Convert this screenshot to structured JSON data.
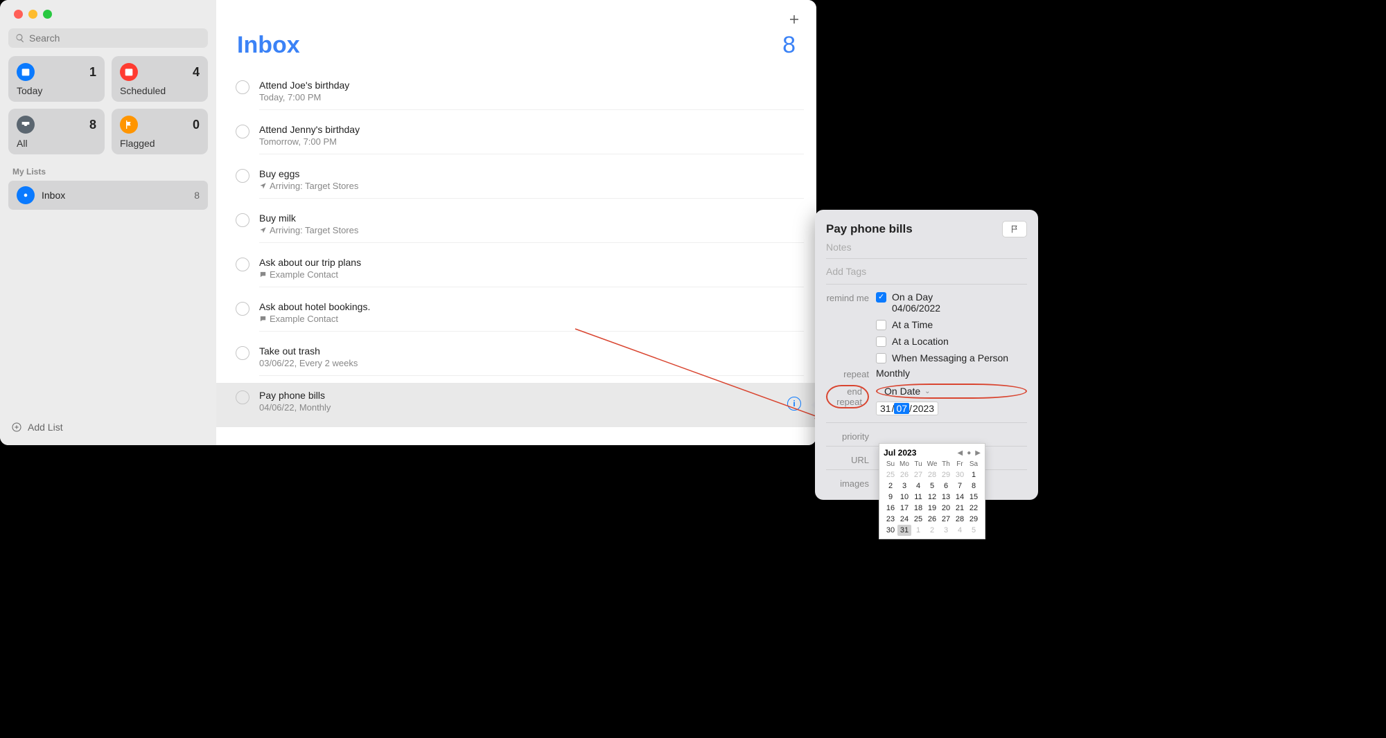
{
  "window": {
    "search_placeholder": "Search",
    "smart": {
      "today": {
        "label": "Today",
        "count": "1"
      },
      "scheduled": {
        "label": "Scheduled",
        "count": "4"
      },
      "all": {
        "label": "All",
        "count": "8"
      },
      "flagged": {
        "label": "Flagged",
        "count": "0"
      }
    },
    "lists_header": "My Lists",
    "lists": [
      {
        "name": "Inbox",
        "count": "8"
      }
    ],
    "add_list": "Add List"
  },
  "main": {
    "title": "Inbox",
    "count": "8",
    "reminders": [
      {
        "title": "Attend Joe's birthday",
        "meta": "Today, 7:00 PM",
        "icon": "none"
      },
      {
        "title": "Attend Jenny's birthday",
        "meta": "Tomorrow, 7:00 PM",
        "icon": "none"
      },
      {
        "title": "Buy eggs",
        "meta": "Arriving: Target Stores",
        "icon": "location"
      },
      {
        "title": "Buy milk",
        "meta": "Arriving: Target Stores",
        "icon": "location"
      },
      {
        "title": "Ask about our trip plans",
        "meta": "Example Contact",
        "icon": "contact"
      },
      {
        "title": "Ask about hotel bookings.",
        "meta": "Example Contact",
        "icon": "contact"
      },
      {
        "title": "Take out trash",
        "meta": "03/06/22, Every 2 weeks",
        "icon": "none"
      },
      {
        "title": "Pay phone bills",
        "meta": "04/06/22, Monthly",
        "icon": "none"
      }
    ]
  },
  "inspector": {
    "title": "Pay phone bills",
    "notes_placeholder": "Notes",
    "tags_placeholder": "Add Tags",
    "remind_label": "remind me",
    "opts": {
      "on_a_day": {
        "label": "On a Day",
        "date": "04/06/2022"
      },
      "at_a_time": {
        "label": "At a Time"
      },
      "at_a_location": {
        "label": "At a Location"
      },
      "when_messaging": {
        "label": "When Messaging a Person"
      }
    },
    "repeat_label": "repeat",
    "repeat_value": "Monthly",
    "end_repeat_label": "end repeat",
    "end_repeat_value": "On Date",
    "end_repeat_date": {
      "d": "31",
      "m": "07",
      "y": "2023"
    },
    "priority_label": "priority",
    "url_label": "URL",
    "images_label": "images"
  },
  "calendar": {
    "month": "Jul 2023",
    "dow": [
      "Su",
      "Mo",
      "Tu",
      "We",
      "Th",
      "Fr",
      "Sa"
    ],
    "weeks": [
      [
        {
          "d": "25",
          "m": true
        },
        {
          "d": "26",
          "m": true
        },
        {
          "d": "27",
          "m": true
        },
        {
          "d": "28",
          "m": true
        },
        {
          "d": "29",
          "m": true
        },
        {
          "d": "30",
          "m": true
        },
        {
          "d": "1"
        }
      ],
      [
        {
          "d": "2"
        },
        {
          "d": "3"
        },
        {
          "d": "4"
        },
        {
          "d": "5"
        },
        {
          "d": "6"
        },
        {
          "d": "7"
        },
        {
          "d": "8"
        }
      ],
      [
        {
          "d": "9"
        },
        {
          "d": "10"
        },
        {
          "d": "11"
        },
        {
          "d": "12"
        },
        {
          "d": "13"
        },
        {
          "d": "14"
        },
        {
          "d": "15"
        }
      ],
      [
        {
          "d": "16"
        },
        {
          "d": "17"
        },
        {
          "d": "18"
        },
        {
          "d": "19"
        },
        {
          "d": "20"
        },
        {
          "d": "21"
        },
        {
          "d": "22"
        }
      ],
      [
        {
          "d": "23"
        },
        {
          "d": "24"
        },
        {
          "d": "25"
        },
        {
          "d": "26"
        },
        {
          "d": "27"
        },
        {
          "d": "28"
        },
        {
          "d": "29"
        }
      ],
      [
        {
          "d": "30"
        },
        {
          "d": "31",
          "sel": true
        },
        {
          "d": "1",
          "m": true
        },
        {
          "d": "2",
          "m": true
        },
        {
          "d": "3",
          "m": true
        },
        {
          "d": "4",
          "m": true
        },
        {
          "d": "5",
          "m": true
        }
      ]
    ]
  }
}
